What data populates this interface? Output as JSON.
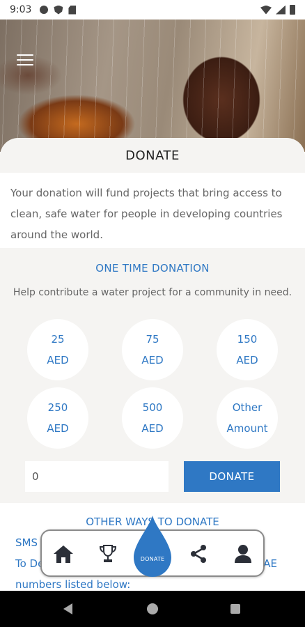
{
  "status_bar": {
    "time": "9:03",
    "left_icons": [
      "gear-icon",
      "shield-icon",
      "sd-card-icon"
    ],
    "right_icons": [
      "wifi-icon",
      "signal-icon",
      "battery-icon"
    ]
  },
  "header": {
    "menu_icon": "hamburger-icon",
    "title": "DONATE"
  },
  "intro": {
    "text": "Your donation will fund projects that bring access to clean, safe water for people in developing countries around the world."
  },
  "one_time": {
    "heading": "ONE TIME DONATION",
    "subtitle": "Help contribute a water project for a community in need.",
    "amounts": [
      {
        "line1": "25",
        "line2": "AED"
      },
      {
        "line1": "75",
        "line2": "AED"
      },
      {
        "line1": "150",
        "line2": "AED"
      },
      {
        "line1": "250",
        "line2": "AED"
      },
      {
        "line1": "500",
        "line2": "AED"
      },
      {
        "line1": "Other",
        "line2": "Amount"
      }
    ],
    "input_value": "0",
    "donate_button": "DONATE"
  },
  "other_ways": {
    "heading": "OTHER WAYS TO DONATE",
    "sms_label": "SMS",
    "to_text": "To De",
    "uae_text": "AE",
    "numbers_text": "numbers listed below:"
  },
  "bottom_nav": {
    "items": [
      "home-icon",
      "trophy-icon",
      "donate-drop-icon",
      "share-icon",
      "profile-icon"
    ],
    "donate_label": "DONATE"
  },
  "colors": {
    "accent": "#2f78c4",
    "panel_bg": "#f5f4f2",
    "text_gray": "#666666"
  }
}
